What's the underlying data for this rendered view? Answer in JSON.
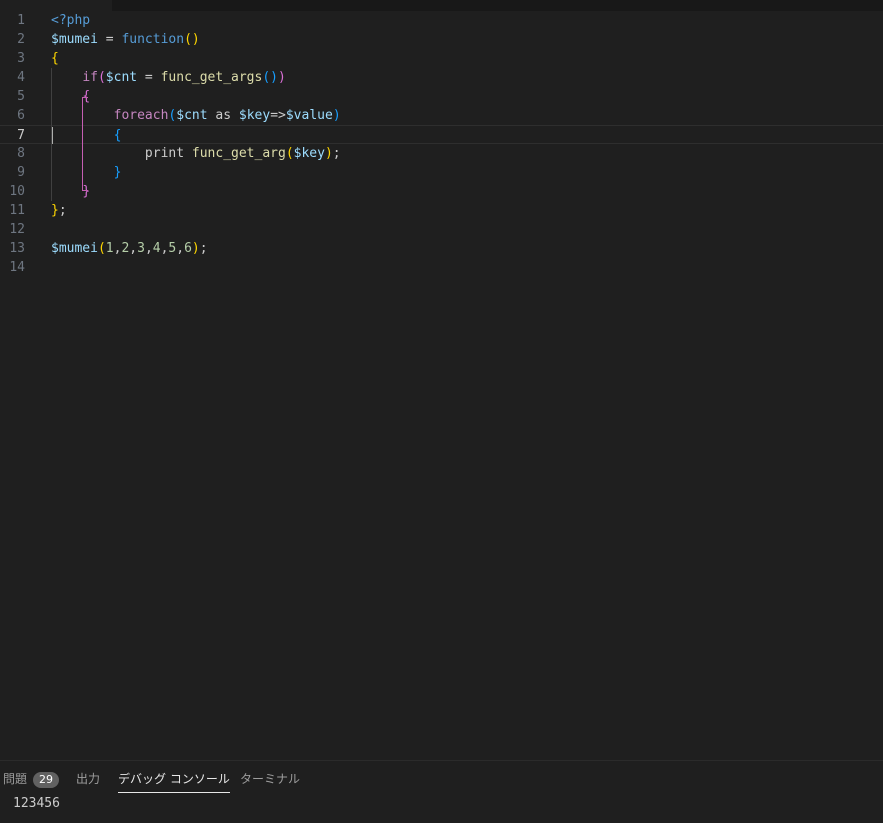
{
  "editor": {
    "active_line": 7,
    "lines": [
      {
        "n": "1",
        "segs": [
          {
            "t": "<?php",
            "c": "c-tag"
          }
        ]
      },
      {
        "n": "2",
        "segs": [
          {
            "t": "$mumei",
            "c": "c-var"
          },
          {
            "t": " = ",
            "c": "c-txt"
          },
          {
            "t": "function",
            "c": "c-kw"
          },
          {
            "t": "()",
            "c": "b1"
          }
        ]
      },
      {
        "n": "3",
        "segs": [
          {
            "t": "{",
            "c": "b1"
          }
        ]
      },
      {
        "n": "4",
        "segs": [
          {
            "t": "    ",
            "c": "c-txt"
          },
          {
            "t": "if",
            "c": "c-ctl"
          },
          {
            "t": "(",
            "c": "b2"
          },
          {
            "t": "$cnt",
            "c": "c-var"
          },
          {
            "t": " = ",
            "c": "c-txt"
          },
          {
            "t": "func_get_args",
            "c": "c-fn"
          },
          {
            "t": "()",
            "c": "b3"
          },
          {
            "t": ")",
            "c": "b2"
          }
        ]
      },
      {
        "n": "5",
        "segs": [
          {
            "t": "    ",
            "c": "c-txt"
          },
          {
            "t": "{",
            "c": "b2"
          }
        ]
      },
      {
        "n": "6",
        "segs": [
          {
            "t": "        ",
            "c": "c-txt"
          },
          {
            "t": "foreach",
            "c": "c-ctl"
          },
          {
            "t": "(",
            "c": "b3"
          },
          {
            "t": "$cnt",
            "c": "c-var"
          },
          {
            "t": " as ",
            "c": "c-txt"
          },
          {
            "t": "$key",
            "c": "c-var"
          },
          {
            "t": "=>",
            "c": "c-txt"
          },
          {
            "t": "$value",
            "c": "c-var"
          },
          {
            "t": ")",
            "c": "b3"
          }
        ]
      },
      {
        "n": "7",
        "segs": [
          {
            "t": "        ",
            "c": "c-txt"
          },
          {
            "t": "{",
            "c": "b3"
          }
        ]
      },
      {
        "n": "8",
        "segs": [
          {
            "t": "            ",
            "c": "c-txt"
          },
          {
            "t": "print ",
            "c": "c-txt"
          },
          {
            "t": "func_get_arg",
            "c": "c-fn"
          },
          {
            "t": "(",
            "c": "b1"
          },
          {
            "t": "$key",
            "c": "c-var"
          },
          {
            "t": ")",
            "c": "b1"
          },
          {
            "t": ";",
            "c": "c-txt"
          }
        ]
      },
      {
        "n": "9",
        "segs": [
          {
            "t": "        ",
            "c": "c-txt"
          },
          {
            "t": "}",
            "c": "b3"
          }
        ]
      },
      {
        "n": "10",
        "segs": [
          {
            "t": "    ",
            "c": "c-txt"
          },
          {
            "t": "}",
            "c": "b2"
          }
        ]
      },
      {
        "n": "11",
        "segs": [
          {
            "t": "}",
            "c": "b1"
          },
          {
            "t": ";",
            "c": "c-txt"
          }
        ]
      },
      {
        "n": "12",
        "segs": []
      },
      {
        "n": "13",
        "segs": [
          {
            "t": "$mumei",
            "c": "c-var"
          },
          {
            "t": "(",
            "c": "b1"
          },
          {
            "t": "1",
            "c": "c-num"
          },
          {
            "t": ",",
            "c": "c-txt"
          },
          {
            "t": "2",
            "c": "c-num"
          },
          {
            "t": ",",
            "c": "c-txt"
          },
          {
            "t": "3",
            "c": "c-num"
          },
          {
            "t": ",",
            "c": "c-txt"
          },
          {
            "t": "4",
            "c": "c-num"
          },
          {
            "t": ",",
            "c": "c-txt"
          },
          {
            "t": "5",
            "c": "c-num"
          },
          {
            "t": ",",
            "c": "c-txt"
          },
          {
            "t": "6",
            "c": "c-num"
          },
          {
            "t": ")",
            "c": "b1"
          },
          {
            "t": ";",
            "c": "c-txt"
          }
        ]
      },
      {
        "n": "14",
        "segs": []
      }
    ]
  },
  "panel": {
    "tabs": {
      "problems": {
        "label": "問題",
        "count": "29"
      },
      "output": {
        "label": "出力"
      },
      "debug_console": {
        "label": "デバッグ コンソール"
      },
      "terminal": {
        "label": "ターミナル"
      }
    },
    "console_output": "123456"
  }
}
